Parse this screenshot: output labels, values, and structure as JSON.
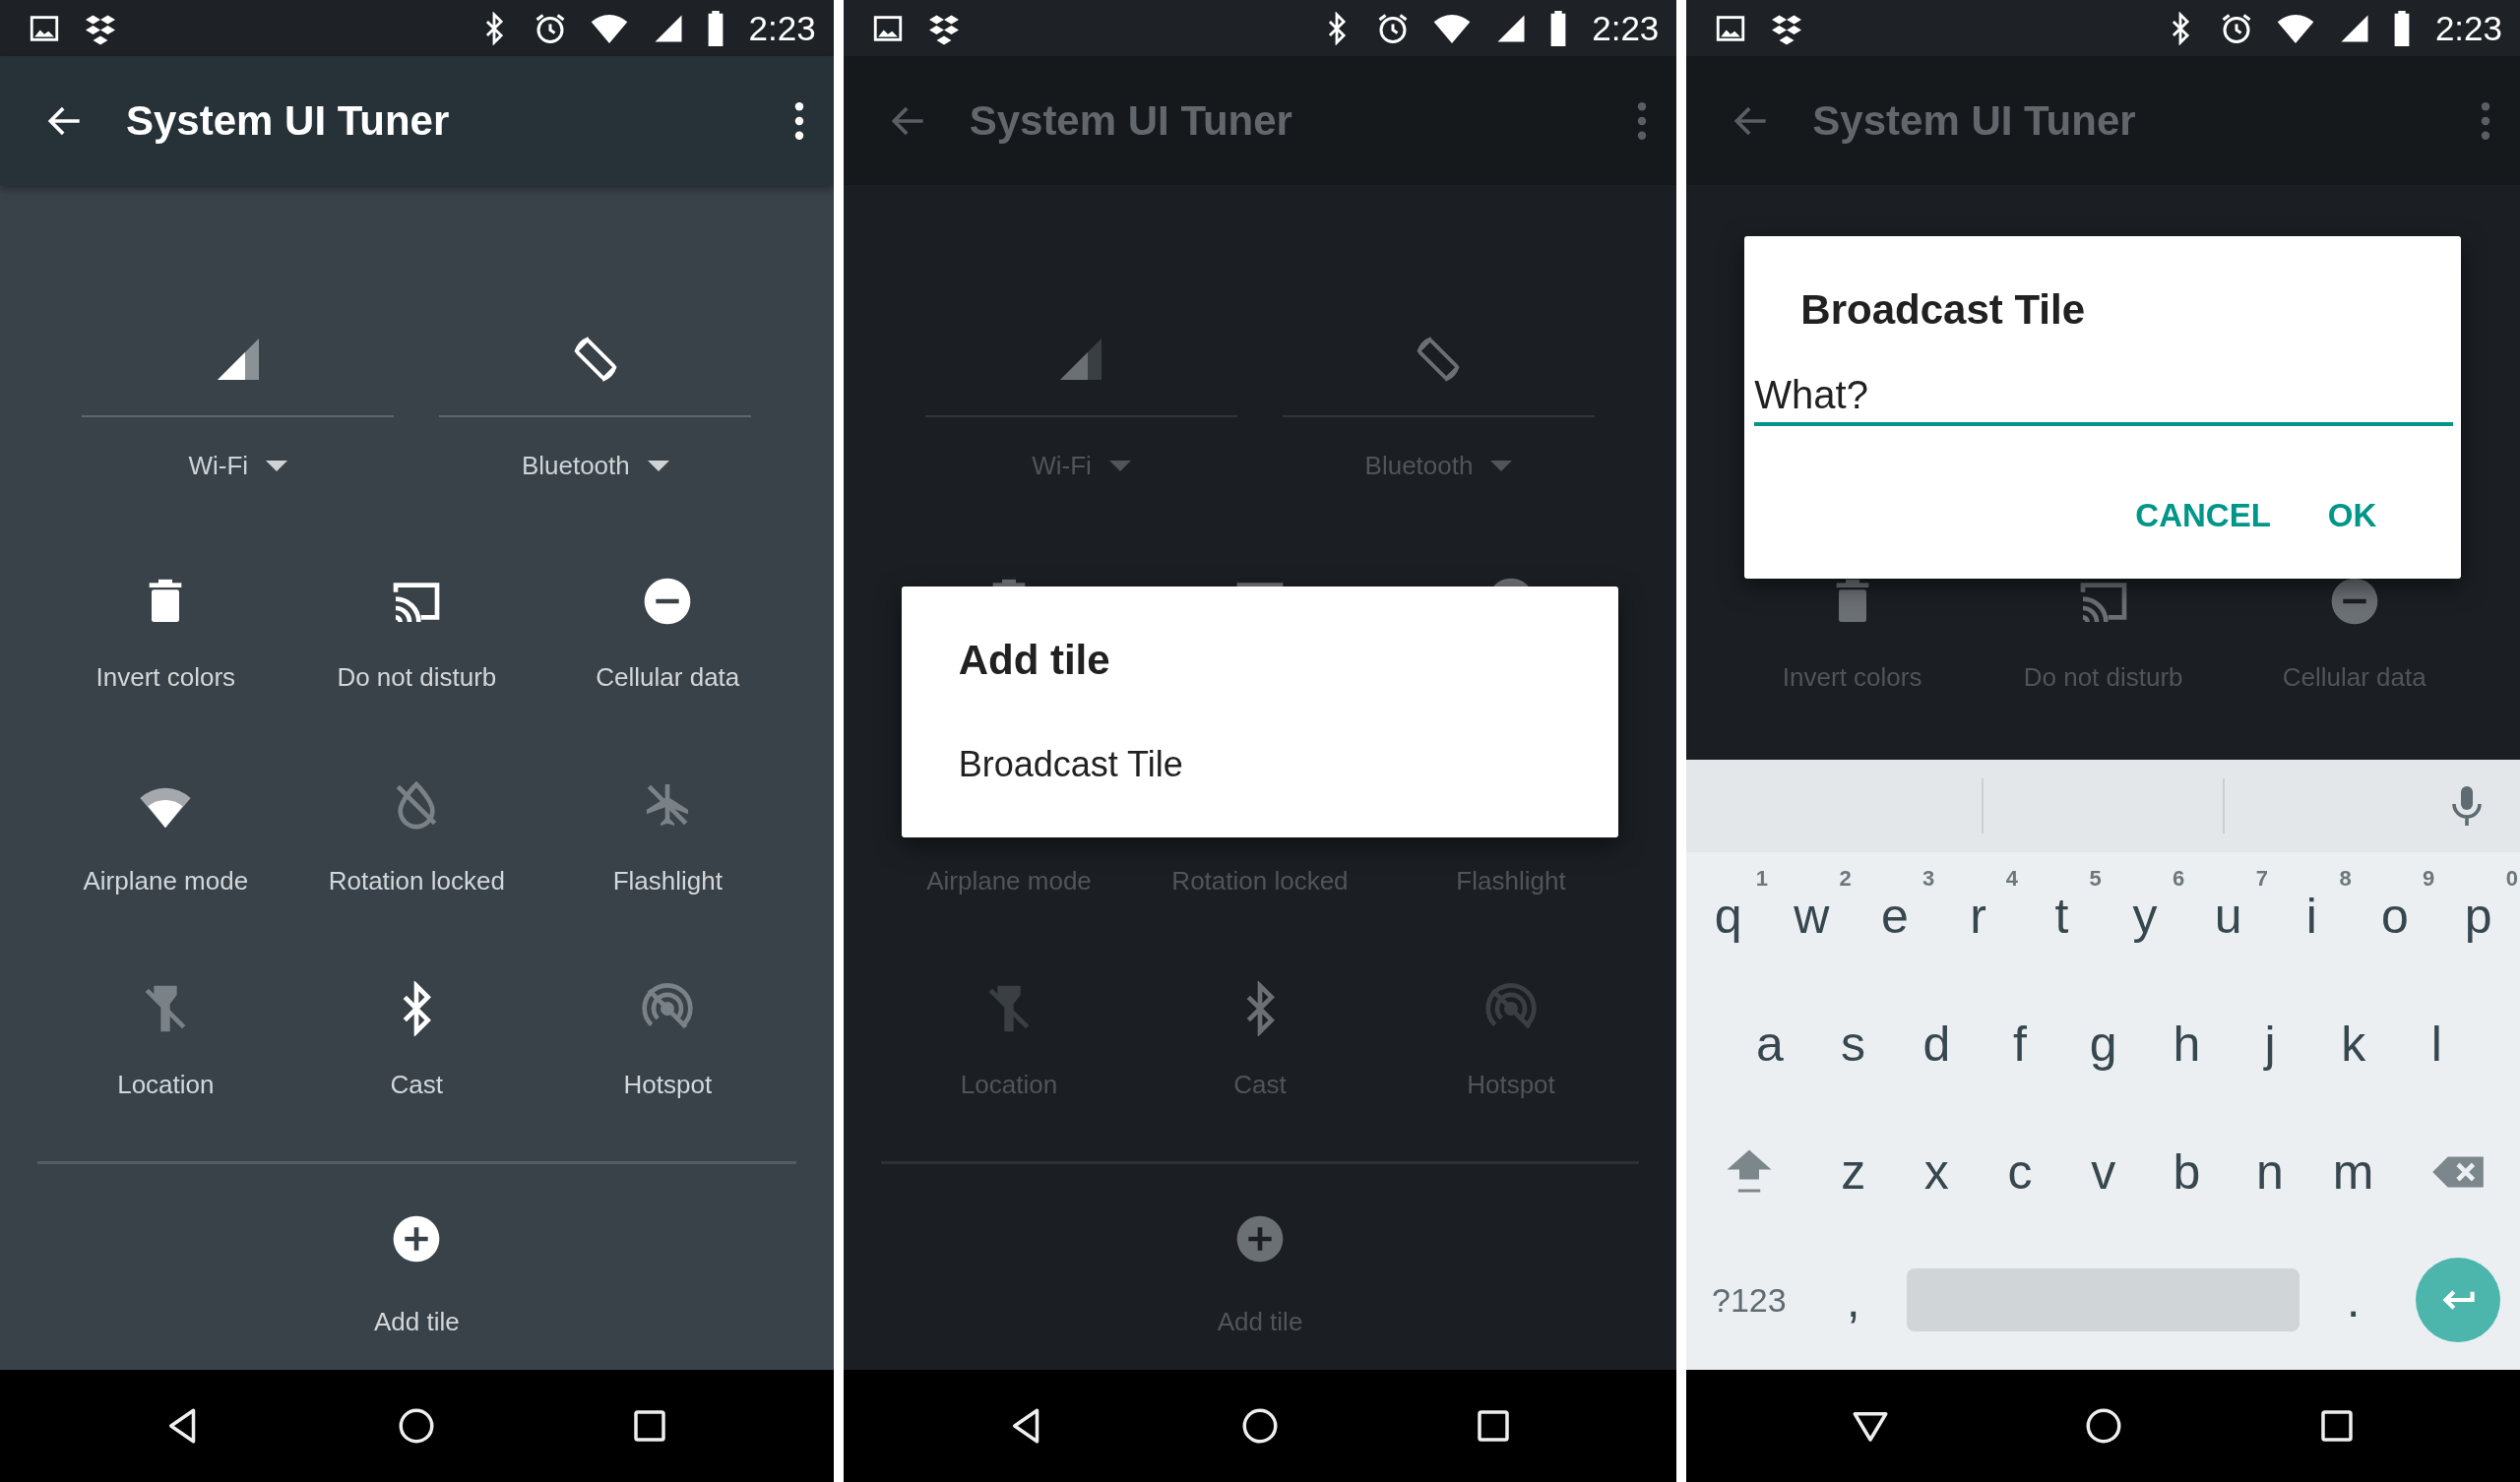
{
  "phones": [
    {
      "dimmed": false,
      "status_bar": {
        "time": "2:23"
      },
      "app_bar": {
        "title": "System UI Tuner"
      },
      "big_tiles": [
        {
          "label": "Wi-Fi"
        },
        {
          "label": "Bluetooth"
        }
      ],
      "tiles": [
        {
          "label": "Invert colors",
          "on": true,
          "icon_shown": true
        },
        {
          "label": "Do not disturb",
          "on": true,
          "icon_shown": true
        },
        {
          "label": "Cellular data",
          "on": true,
          "icon_shown": true
        },
        {
          "label": "Airplane mode",
          "on": true,
          "icon_shown": true
        },
        {
          "label": "Rotation locked",
          "on": false,
          "icon_shown": true
        },
        {
          "label": "Flashlight",
          "on": false,
          "icon_shown": true
        },
        {
          "label": "Location",
          "on": false,
          "icon_shown": true
        },
        {
          "label": "Cast",
          "on": true,
          "icon_shown": true
        },
        {
          "label": "Hotspot",
          "on": false,
          "icon_shown": true
        }
      ],
      "add_tile": {
        "label": "Add tile"
      }
    },
    {
      "dimmed": true,
      "status_bar": {
        "time": "2:23"
      },
      "app_bar": {
        "title": "System UI Tuner"
      },
      "big_tiles": [
        {
          "label": "Wi-Fi"
        },
        {
          "label": "Bluetooth"
        }
      ],
      "tiles": [
        {
          "on": true,
          "icon_shown": true
        },
        {
          "on": true,
          "icon_shown": true
        },
        {
          "on": true,
          "icon_shown": true
        },
        {
          "label": "Airplane mode",
          "icon_shown": false
        },
        {
          "label": "Rotation locked",
          "icon_shown": false
        },
        {
          "label": "Flashlight",
          "icon_shown": false
        },
        {
          "label": "Location",
          "on": false,
          "icon_shown": true
        },
        {
          "label": "Cast",
          "on": true,
          "icon_shown": true
        },
        {
          "label": "Hotspot",
          "on": false,
          "icon_shown": true
        }
      ],
      "add_tile": {
        "label": "Add tile"
      },
      "dialog": {
        "kind": "list",
        "title": "Add tile",
        "items": [
          "Broadcast Tile"
        ]
      }
    },
    {
      "dimmed": true,
      "status_bar": {
        "time": "2:23"
      },
      "app_bar": {
        "title": "System UI Tuner"
      },
      "tiles": [
        {
          "label": "Invert colors",
          "on": true,
          "icon_shown": true
        },
        {
          "label": "Do not disturb",
          "on": true,
          "icon_shown": true
        },
        {
          "label": "Cellular data",
          "on": true,
          "icon_shown": true
        }
      ],
      "dialog": {
        "kind": "input",
        "title": "Broadcast Tile",
        "value": "What?",
        "buttons": [
          "CANCEL",
          "OK"
        ]
      },
      "keyboard": {
        "rows": [
          {
            "keys": [
              {
                "kind": "letter",
                "label": "q",
                "hint": "1"
              },
              {
                "kind": "letter",
                "label": "w",
                "hint": "2"
              },
              {
                "kind": "letter",
                "label": "e",
                "hint": "3"
              },
              {
                "kind": "letter",
                "label": "r",
                "hint": "4"
              },
              {
                "kind": "letter",
                "label": "t",
                "hint": "5"
              },
              {
                "kind": "letter",
                "label": "y",
                "hint": "6"
              },
              {
                "kind": "letter",
                "label": "u",
                "hint": "7"
              },
              {
                "kind": "letter",
                "label": "i",
                "hint": "8"
              },
              {
                "kind": "letter",
                "label": "o",
                "hint": "9"
              },
              {
                "kind": "letter",
                "label": "p",
                "hint": "0"
              }
            ]
          },
          {
            "keys": [
              {
                "kind": "letter",
                "label": "a"
              },
              {
                "kind": "letter",
                "label": "s"
              },
              {
                "kind": "letter",
                "label": "d"
              },
              {
                "kind": "letter",
                "label": "f"
              },
              {
                "kind": "letter",
                "label": "g"
              },
              {
                "kind": "letter",
                "label": "h"
              },
              {
                "kind": "letter",
                "label": "j"
              },
              {
                "kind": "letter",
                "label": "k"
              },
              {
                "kind": "letter",
                "label": "l"
              }
            ]
          },
          {
            "keys": [
              {
                "kind": "shift"
              },
              {
                "kind": "letter",
                "label": "z"
              },
              {
                "kind": "letter",
                "label": "x"
              },
              {
                "kind": "letter",
                "label": "c"
              },
              {
                "kind": "letter",
                "label": "v"
              },
              {
                "kind": "letter",
                "label": "b"
              },
              {
                "kind": "letter",
                "label": "n"
              },
              {
                "kind": "letter",
                "label": "m"
              },
              {
                "kind": "backspace"
              }
            ]
          },
          {
            "keys": [
              {
                "kind": "symbols",
                "label": "?123"
              },
              {
                "kind": "letter",
                "label": ","
              },
              {
                "kind": "space"
              },
              {
                "kind": "letter",
                "label": "."
              },
              {
                "kind": "enter"
              }
            ]
          }
        ]
      }
    }
  ]
}
